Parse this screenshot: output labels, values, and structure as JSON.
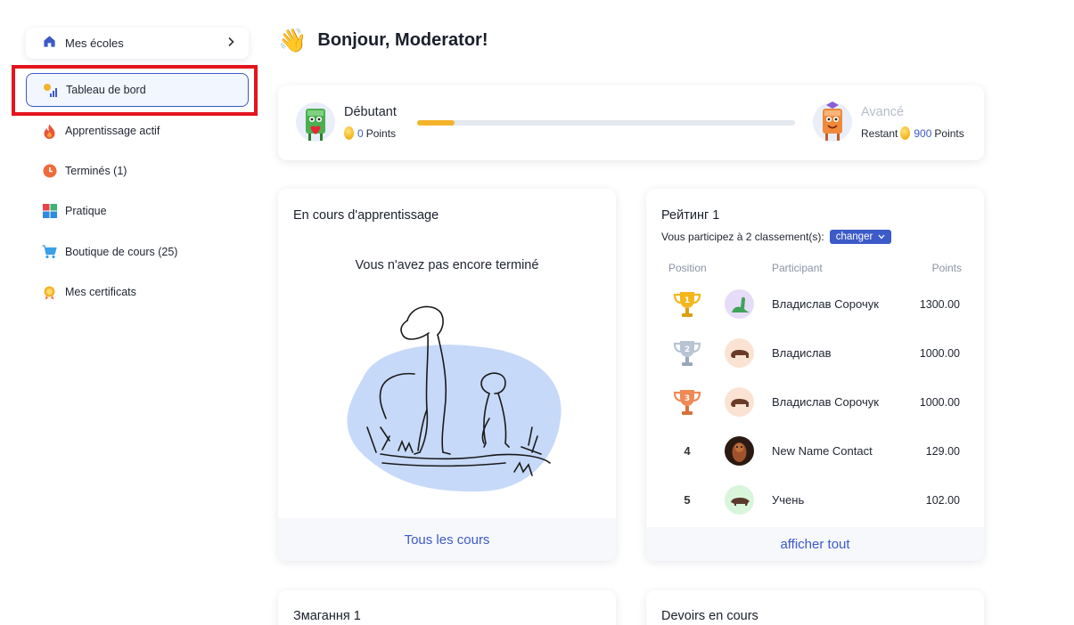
{
  "sidebar": {
    "schools_label": "Mes écoles",
    "items": [
      {
        "label": "Tableau de bord",
        "icon": "dashboard-chart-icon"
      },
      {
        "label": "Apprentissage actif",
        "icon": "fire-icon"
      },
      {
        "label": "Terminés (1)",
        "icon": "clock-icon"
      },
      {
        "label": "Pratique",
        "icon": "grid-icon"
      },
      {
        "label": "Boutique de cours (25)",
        "icon": "cart-icon"
      },
      {
        "label": "Mes certificats",
        "icon": "medal-icon"
      }
    ]
  },
  "header": {
    "greeting": "Bonjour, Moderator!",
    "wave": "👋"
  },
  "level": {
    "current_name": "Débutant",
    "current_points": "0",
    "points_word": "Points",
    "next_name": "Avancé",
    "remaining_label": "Restant",
    "remaining_points": "900",
    "progress_fraction": 0.1
  },
  "courses": {
    "title": "En cours d'apprentissage",
    "empty_message": "Vous n'avez pas encore terminé",
    "footer_link": "Tous les cours"
  },
  "rating": {
    "title": "Рейтинг 1",
    "participation_text": "Vous participez à 2 classement(s):",
    "change_button": "changer",
    "columns": {
      "position": "Position",
      "participant": "Participant",
      "points": "Points"
    },
    "rows": [
      {
        "position": "1",
        "name": "Владислав Сорочук",
        "points": "1300.00",
        "trophy": "gold"
      },
      {
        "position": "2",
        "name": "Владислав",
        "points": "1000.00",
        "trophy": "silver"
      },
      {
        "position": "3",
        "name": "Владислав Сорочук",
        "points": "1000.00",
        "trophy": "bronze"
      },
      {
        "position": "4",
        "name": "New Name Contact",
        "points": "129.00",
        "trophy": ""
      },
      {
        "position": "5",
        "name": "Учень",
        "points": "102.00",
        "trophy": ""
      }
    ],
    "footer_link": "afficher tout"
  },
  "bottom_cards": {
    "left_title": "Змагання 1",
    "right_title": "Devoirs en cours"
  },
  "colors": {
    "accent": "#3c5ac8",
    "highlight": "#e3141b",
    "progress": "#f4b32a"
  }
}
